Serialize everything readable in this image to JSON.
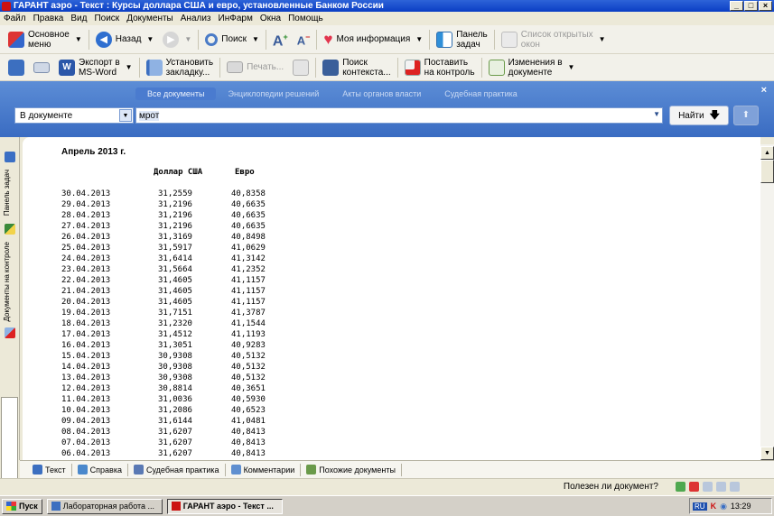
{
  "window": {
    "title": "ГАРАНТ аэро - Текст : Курсы доллара США и евро, установленные Банком России",
    "buttons": [
      "_",
      "□",
      "×"
    ]
  },
  "menu": [
    "Файл",
    "Правка",
    "Вид",
    "Поиск",
    "Документы",
    "Анализ",
    "ИнФарм",
    "Окна",
    "Помощь"
  ],
  "toolbar1": {
    "main_menu": "Основное\nменю",
    "back": "Назад",
    "search": "Поиск",
    "my_info": "Моя информация",
    "task_panel": "Панель\nзадач",
    "open_windows": "Список открытых\nокон"
  },
  "toolbar2": {
    "export": "Экспорт в\nMS-Word",
    "bookmark": "Установить\nзакладку...",
    "print": "Печать...",
    "context_search": "Поиск\nконтекста...",
    "control": "Поставить\nна контроль",
    "changes": "Изменения в\nдокументе"
  },
  "search": {
    "tabs": [
      "Все документы",
      "Энциклопедии решений",
      "Акты органов власти",
      "Судебная практика"
    ],
    "scope": "В документе",
    "query": "мрот",
    "find_label": "Найти"
  },
  "side": {
    "task_panel": "Панель задач",
    "docs_on_control": "Документы на контроле"
  },
  "document": {
    "title": "Апрель 2013 г.",
    "col_usd": "Доллар США",
    "col_eur": "Евро",
    "rows": [
      [
        "30.04.2013",
        "31,2559",
        "40,8358"
      ],
      [
        "29.04.2013",
        "31,2196",
        "40,6635"
      ],
      [
        "28.04.2013",
        "31,2196",
        "40,6635"
      ],
      [
        "27.04.2013",
        "31,2196",
        "40,6635"
      ],
      [
        "26.04.2013",
        "31,3169",
        "40,8498"
      ],
      [
        "25.04.2013",
        "31,5917",
        "41,0629"
      ],
      [
        "24.04.2013",
        "31,6414",
        "41,3142"
      ],
      [
        "23.04.2013",
        "31,5664",
        "41,2352"
      ],
      [
        "22.04.2013",
        "31,4605",
        "41,1157"
      ],
      [
        "21.04.2013",
        "31,4605",
        "41,1157"
      ],
      [
        "20.04.2013",
        "31,4605",
        "41,1157"
      ],
      [
        "19.04.2013",
        "31,7151",
        "41,3787"
      ],
      [
        "18.04.2013",
        "31,2320",
        "41,1544"
      ],
      [
        "17.04.2013",
        "31,4512",
        "41,1193"
      ],
      [
        "16.04.2013",
        "31,3051",
        "40,9283"
      ],
      [
        "15.04.2013",
        "30,9308",
        "40,5132"
      ],
      [
        "14.04.2013",
        "30,9308",
        "40,5132"
      ],
      [
        "13.04.2013",
        "30,9308",
        "40,5132"
      ],
      [
        "12.04.2013",
        "30,8814",
        "40,3651"
      ],
      [
        "11.04.2013",
        "31,0036",
        "40,5930"
      ],
      [
        "10.04.2013",
        "31,2086",
        "40,6523"
      ],
      [
        "09.04.2013",
        "31,6144",
        "41,0481"
      ],
      [
        "08.04.2013",
        "31,6207",
        "40,8413"
      ],
      [
        "07.04.2013",
        "31,6207",
        "40,8413"
      ],
      [
        "06.04.2013",
        "31,6207",
        "40,8413"
      ]
    ]
  },
  "bottom_tabs": [
    "Текст",
    "Справка",
    "Судебная практика",
    "Комментарии",
    "Похожие документы"
  ],
  "status": {
    "useful": "Полезен ли документ?"
  },
  "taskbar": {
    "start": "Пуск",
    "tasks": [
      "Лабораторная работа ...",
      "ГАРАНТ аэро - Текст ..."
    ],
    "lang": "RU",
    "time": "13:29"
  }
}
